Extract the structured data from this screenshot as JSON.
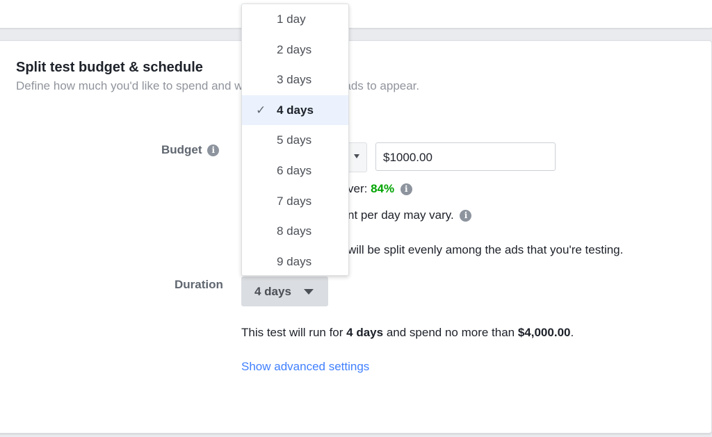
{
  "section": {
    "title": "Split test budget & schedule",
    "subtitle": "Define how much you'd like to spend and when you'd like your ads to appear."
  },
  "budget": {
    "label": "Budget",
    "info_icon": "info-icon",
    "amount_value": "$1000.00",
    "power_prefix": "ver: ",
    "power_value": "84%",
    "vary_text": "nt per day may vary.",
    "split_text": "will be split evenly among the ads that you're testing."
  },
  "duration": {
    "label": "Duration",
    "selected": "4 days",
    "caret_icon": "caret-down-icon",
    "summary_pre": "This test will run for ",
    "summary_days": "4 days",
    "summary_mid": " and spend no more than ",
    "summary_amount": "$4,000.00",
    "summary_post": ".",
    "options": [
      "1 day",
      "2 days",
      "3 days",
      "4 days",
      "5 days",
      "6 days",
      "7 days",
      "8 days",
      "9 days"
    ],
    "check_glyph": "✓"
  },
  "advanced_link": "Show advanced settings",
  "colors": {
    "accent_link": "#4080ff",
    "power_green": "#00a400",
    "selected_bg": "#ebf2fd"
  }
}
